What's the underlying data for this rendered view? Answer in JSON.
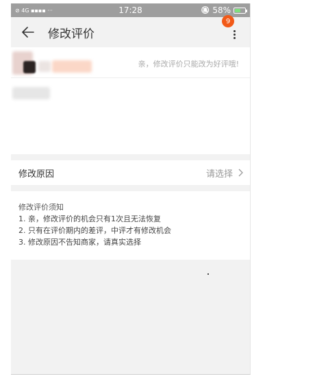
{
  "status_bar": {
    "left_icons": "⊘ 4G ▪▪▪▪ ···",
    "time": "17:28",
    "bell": "🔕",
    "battery_percent": "58%",
    "battery_level": 0.58
  },
  "header": {
    "title": "修改评价",
    "back_icon": "arrow-left-icon",
    "more_icon": "more-vertical-icon",
    "badge_count": "9"
  },
  "review": {
    "hint": "亲，修改评价只能改为好评哦!"
  },
  "reason_row": {
    "label": "修改原因",
    "value": "请选择"
  },
  "notes": {
    "title": "修改评价须知",
    "items": [
      "1. 亲，修改评价的机会只有1次且无法恢复",
      "2. 只有在评价期内的差评，中评才有修改机会",
      "3. 修改原因不告知商家，请真实选择"
    ]
  },
  "colors": {
    "accent": "#f25a18",
    "status_bar": "#9e9e9e",
    "background": "#f2f2f2"
  }
}
